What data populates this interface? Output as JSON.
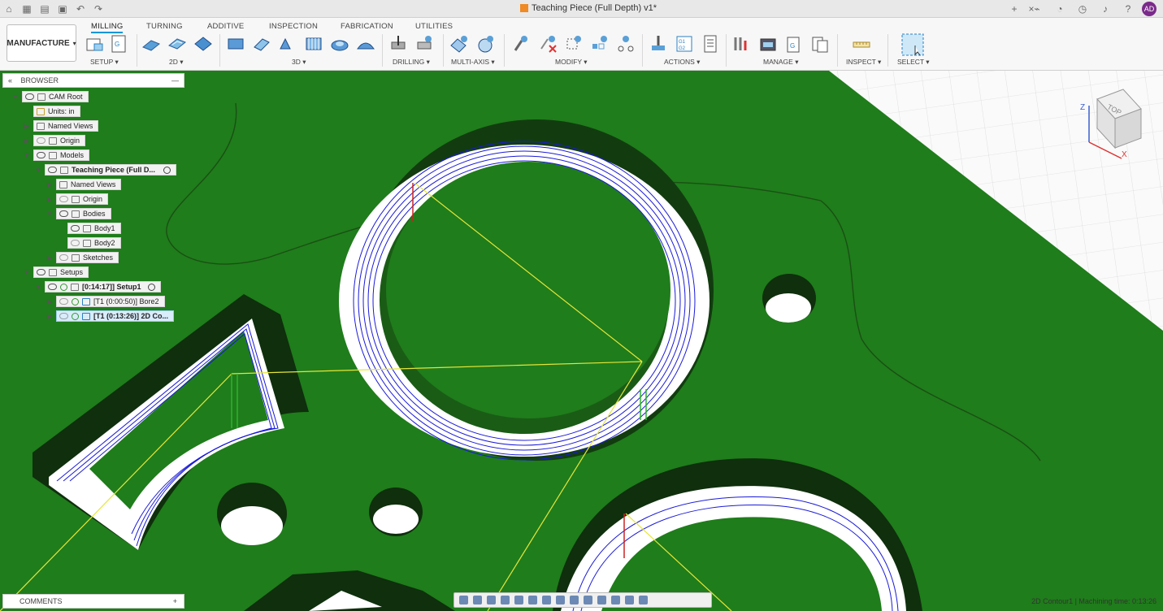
{
  "title_bar": {
    "doc_title": "Teaching Piece (Full Depth) v1*",
    "user_initials": "AD",
    "plus": "+",
    "close": "×"
  },
  "ribbon": {
    "workspace": "MANUFACTURE",
    "tabs": [
      "MILLING",
      "TURNING",
      "ADDITIVE",
      "INSPECTION",
      "FABRICATION",
      "UTILITIES"
    ],
    "groups": [
      "SETUP ▾",
      "2D ▾",
      "3D ▾",
      "DRILLING ▾",
      "MULTI-AXIS ▾",
      "MODIFY ▾",
      "ACTIONS ▾",
      "MANAGE ▾",
      "INSPECT ▾",
      "SELECT ▾"
    ]
  },
  "browser": {
    "title": "BROWSER",
    "items": [
      "CAM Root",
      "Units: in",
      "Named Views",
      "Origin",
      "Models",
      "Teaching Piece (Full D...",
      "Named Views",
      "Origin",
      "Bodies",
      "Body1",
      "Body2",
      "Sketches",
      "Setups",
      "[0:14:17]] Setup1",
      "[T1 (0:00:50)] Bore2",
      "[T1 (0:13:26)] 2D Co..."
    ]
  },
  "comments": {
    "label": "COMMENTS",
    "add": "+"
  },
  "status": {
    "text": "2D Contour1 | Machining time: 0:13:26"
  },
  "viewcube": {
    "top": "TOP",
    "z": "Z",
    "x": "X"
  },
  "colors": {
    "stock": "#1f7d1b",
    "toolpath": "#1a1ad8",
    "rapid": "#e6e63a",
    "accent": "#0696d7"
  }
}
